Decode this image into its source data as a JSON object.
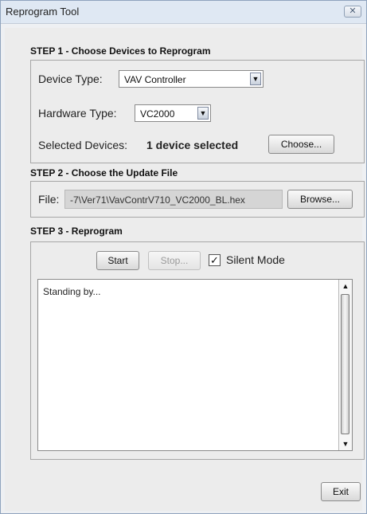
{
  "window": {
    "title": "Reprogram Tool",
    "close_icon": "close-icon"
  },
  "step1": {
    "header": "STEP 1 - Choose Devices to Reprogram",
    "device_type_label": "Device Type:",
    "device_type_value": "VAV Controller",
    "hardware_type_label": "Hardware Type:",
    "hardware_type_value": "VC2000",
    "selected_devices_label": "Selected Devices:",
    "selected_devices_value": "1 device selected",
    "choose_button": "Choose..."
  },
  "step2": {
    "header": "STEP 2 - Choose the Update File",
    "file_label": "File:",
    "file_value": "-7\\Ver71\\VavContrV710_VC2000_BL.hex",
    "browse_button": "Browse..."
  },
  "step3": {
    "header": "STEP 3 - Reprogram",
    "start_button": "Start",
    "stop_button": "Stop...",
    "silent_mode_label": "Silent Mode",
    "silent_mode_checked": true,
    "log_text": "Standing by..."
  },
  "footer": {
    "exit_button": "Exit"
  }
}
